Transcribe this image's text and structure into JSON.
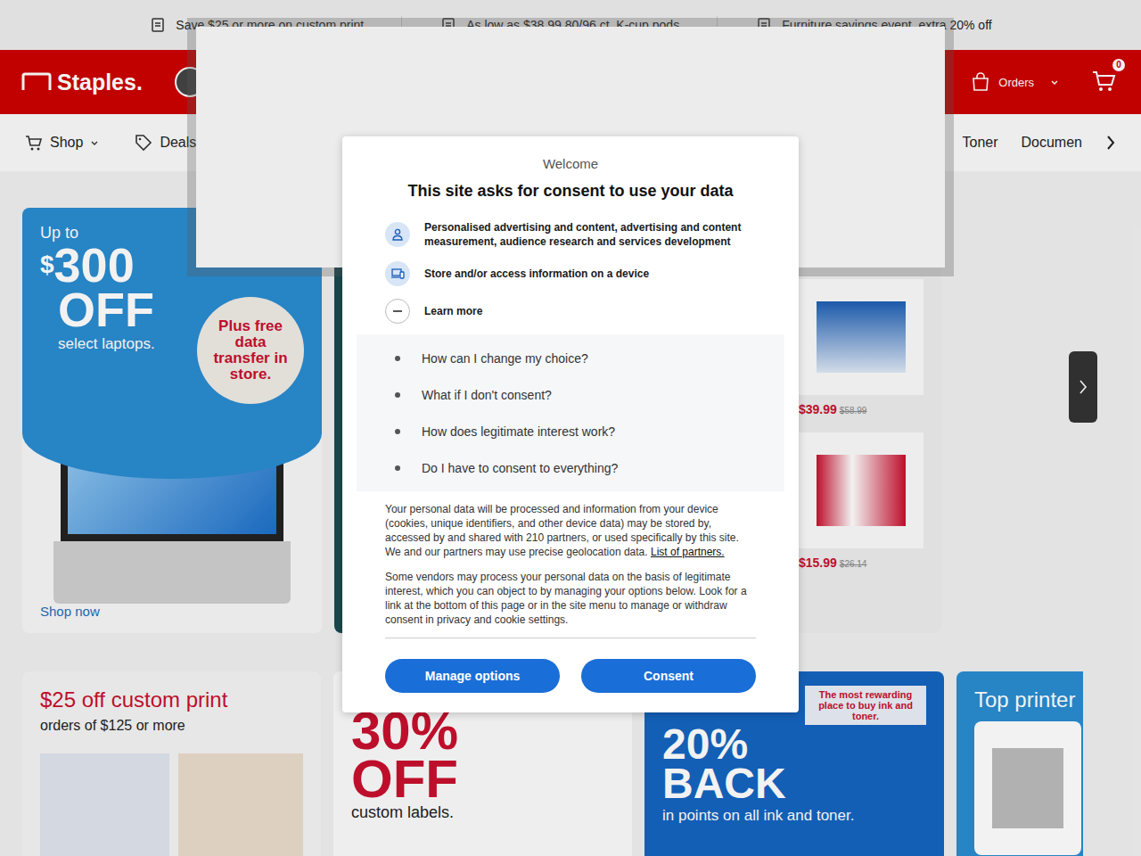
{
  "promo_bar": [
    {
      "text": "Save $25 or more on custom print"
    },
    {
      "text": "As low as $38.99 80/96 ct. K-cup pods"
    },
    {
      "text": "Furniture savings event, extra 20% off"
    }
  ],
  "header": {
    "logo": "Staples.",
    "orders": "Orders",
    "cart_count": "0"
  },
  "nav": {
    "left": [
      {
        "label": "Shop"
      },
      {
        "label": "Deals"
      }
    ],
    "right": [
      {
        "label": "Toner"
      },
      {
        "label": "Documen"
      }
    ]
  },
  "hero": {
    "laptop": {
      "up_to": "Up to",
      "currency": "$",
      "amount": "300",
      "off": "OFF",
      "subtitle": "select laptops.",
      "badge": "Plus free data transfer in store.",
      "cta": "Shop now"
    },
    "products": [
      {
        "price": "$39.99",
        "was": "$58.99"
      },
      {
        "price": "$15.99",
        "was": "$26.14"
      }
    ]
  },
  "promos": [
    {
      "kind": "print",
      "title": "$25 off custom print",
      "subtitle": "orders of $125 or more"
    },
    {
      "kind": "labels",
      "big1": "30%",
      "big2": "OFF",
      "subtitle": "custom labels."
    },
    {
      "kind": "ink",
      "banner": "The most rewarding place to buy ink and toner.",
      "big1": "20%",
      "big2": "BACK",
      "subtitle": "in points on all ink and toner."
    },
    {
      "kind": "printer",
      "title": "Top printer"
    }
  ],
  "consent": {
    "welcome": "Welcome",
    "title": "This site asks for consent to use your data",
    "purposes": [
      {
        "kind": "person",
        "text": "Personalised advertising and content, advertising and content measurement, audience research and services development"
      },
      {
        "kind": "device",
        "text": "Store and/or access information on a device"
      }
    ],
    "learn_more": {
      "label": "Learn more",
      "expanded": true
    },
    "faq": [
      "How can I change my choice?",
      "What if I don't consent?",
      "How does legitimate interest work?",
      "Do I have to consent to everything?"
    ],
    "paragraph1": "Your personal data will be processed and information from your device (cookies, unique identifiers, and other device data) may be stored by, accessed by and shared with 210 partners, or used specifically by this site. We and our partners may use precise geolocation data.",
    "partners_link": "List of partners.",
    "paragraph2": "Some vendors may process your personal data on the basis of legitimate interest, which you can object to by managing your options below. Look for a link at the bottom of this page or in the site menu to manage or withdraw consent in privacy and cookie settings.",
    "buttons": [
      "Manage options",
      "Consent"
    ]
  }
}
